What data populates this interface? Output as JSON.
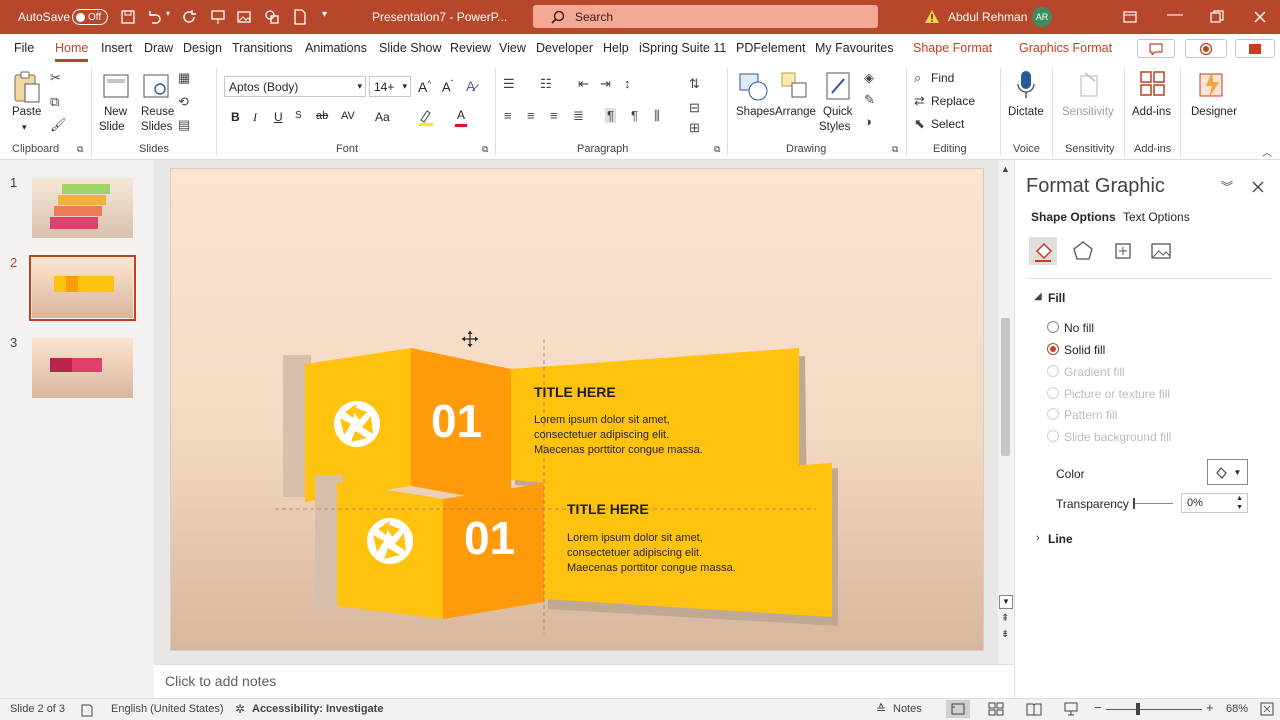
{
  "titlebar": {
    "autosave_label": "AutoSave",
    "autosave_state": "Off",
    "document_title": "Presentation7 - PowerP...",
    "search_placeholder": "Search",
    "user_name": "Abdul Rehman",
    "user_initials": "AR"
  },
  "menu": {
    "tabs": [
      "File",
      "Home",
      "Insert",
      "Draw",
      "Design",
      "Transitions",
      "Animations",
      "Slide Show",
      "Review",
      "View",
      "Developer",
      "Help",
      "iSpring Suite 11",
      "PDFelement",
      "My Favourites",
      "Shape Format",
      "Graphics Format"
    ]
  },
  "ribbon": {
    "clipboard": {
      "paste": "Paste",
      "label": "Clipboard"
    },
    "slides": {
      "new_slide_line1": "New",
      "new_slide_line2": "Slide",
      "reuse_line1": "Reuse",
      "reuse_line2": "Slides",
      "label": "Slides"
    },
    "font": {
      "name": "Aptos (Body)",
      "size": "14+",
      "label": "Font",
      "bold": "B",
      "italic": "I",
      "underline": "U",
      "strike": "ab",
      "case": "Aa",
      "color": "A"
    },
    "paragraph": {
      "label": "Paragraph"
    },
    "drawing": {
      "shapes": "Shapes",
      "arrange": "Arrange",
      "quick_line1": "Quick",
      "quick_line2": "Styles",
      "label": "Drawing"
    },
    "editing": {
      "find": "Find",
      "replace": "Replace",
      "select": "Select",
      "label": "Editing"
    },
    "voice": {
      "dictate": "Dictate",
      "label": "Voice"
    },
    "sensitivity": {
      "button": "Sensitivity",
      "label": "Sensitivity"
    },
    "addins": {
      "button": "Add-ins",
      "label": "Add-ins"
    },
    "designer": {
      "button": "Designer"
    }
  },
  "thumbnails": {
    "numbers": [
      "1",
      "2",
      "3"
    ],
    "selected": "2"
  },
  "slide": {
    "card1": {
      "number": "01",
      "title": "TITLE HERE",
      "line1": "Lorem ipsum dolor sit amet,",
      "line2": "consectetuer adipiscing elit.",
      "line3": "Maecenas porttitor congue massa."
    },
    "card2": {
      "number": "01",
      "title": "TITLE HERE",
      "line1": "Lorem ipsum dolor sit amet,",
      "line2": "consectetuer adipiscing elit.",
      "line3": "Maecenas porttitor congue massa."
    },
    "colors": {
      "light_yellow": "#ffc20e",
      "orange": "#ff9a0a",
      "shadow": "#bfa993"
    }
  },
  "notes": {
    "placeholder": "Click to add notes"
  },
  "pane": {
    "title": "Format Graphic",
    "tab_shape": "Shape Options",
    "tab_text": "Text Options",
    "section_fill": "Fill",
    "fill_options": [
      "No fill",
      "Solid fill",
      "Gradient fill",
      "Picture or texture fill",
      "Pattern fill",
      "Slide background fill"
    ],
    "selected_fill": "Solid fill",
    "color_label": "Color",
    "transparency_label": "Transparency",
    "transparency_value": "0%",
    "section_line": "Line"
  },
  "status": {
    "slide_info": "Slide 2 of 3",
    "language": "English (United States)",
    "accessibility": "Accessibility: Investigate",
    "notes": "Notes",
    "zoom": "68%"
  }
}
